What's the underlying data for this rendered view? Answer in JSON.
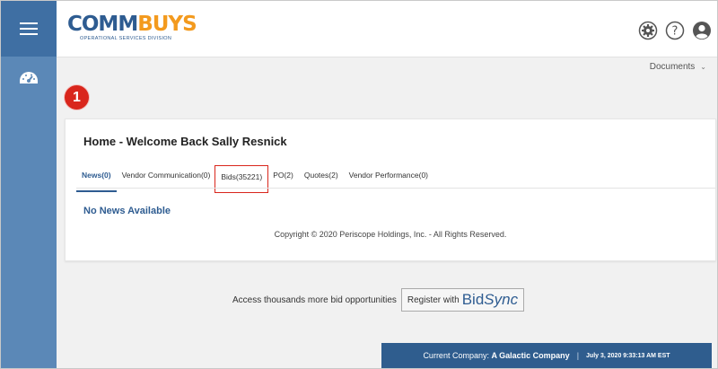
{
  "header": {
    "logo_main_1": "COMM",
    "logo_main_2": "BUYS",
    "logo_sub": "OPERATIONAL SERVICES DIVISION",
    "documents_label": "Documents"
  },
  "badge": "1",
  "home": {
    "title": "Home - Welcome Back Sally Resnick",
    "tabs": [
      {
        "label": "News(0)"
      },
      {
        "label": "Vendor Communication(0)"
      },
      {
        "label": "Bids(35221)"
      },
      {
        "label": "PO(2)"
      },
      {
        "label": "Quotes(2)"
      },
      {
        "label": "Vendor Performance(0)"
      }
    ],
    "no_news": "No News Available",
    "copyright": "Copyright © 2020 Periscope Holdings, Inc. - All Rights Reserved."
  },
  "bidsync": {
    "text": "Access thousands more bid opportunities",
    "button_prefix": "Register with",
    "brand_1": "Bid",
    "brand_2": "Sync"
  },
  "footer": {
    "company_label": "Current Company:",
    "company_name": "A Galactic Company",
    "separator": "|",
    "datetime": "July 3, 2020 9:33:13 AM EST"
  },
  "colors": {
    "rail": "#5b88b7",
    "rail_top": "#3f6fa3",
    "brand_blue": "#2e5c91",
    "brand_orange": "#f39a1e",
    "highlight_red": "#d9261c"
  },
  "icons": [
    "hamburger-menu-icon",
    "dashboard-gauge-icon",
    "settings-gear-icon",
    "help-question-icon",
    "user-account-icon",
    "chevron-down-icon"
  ]
}
